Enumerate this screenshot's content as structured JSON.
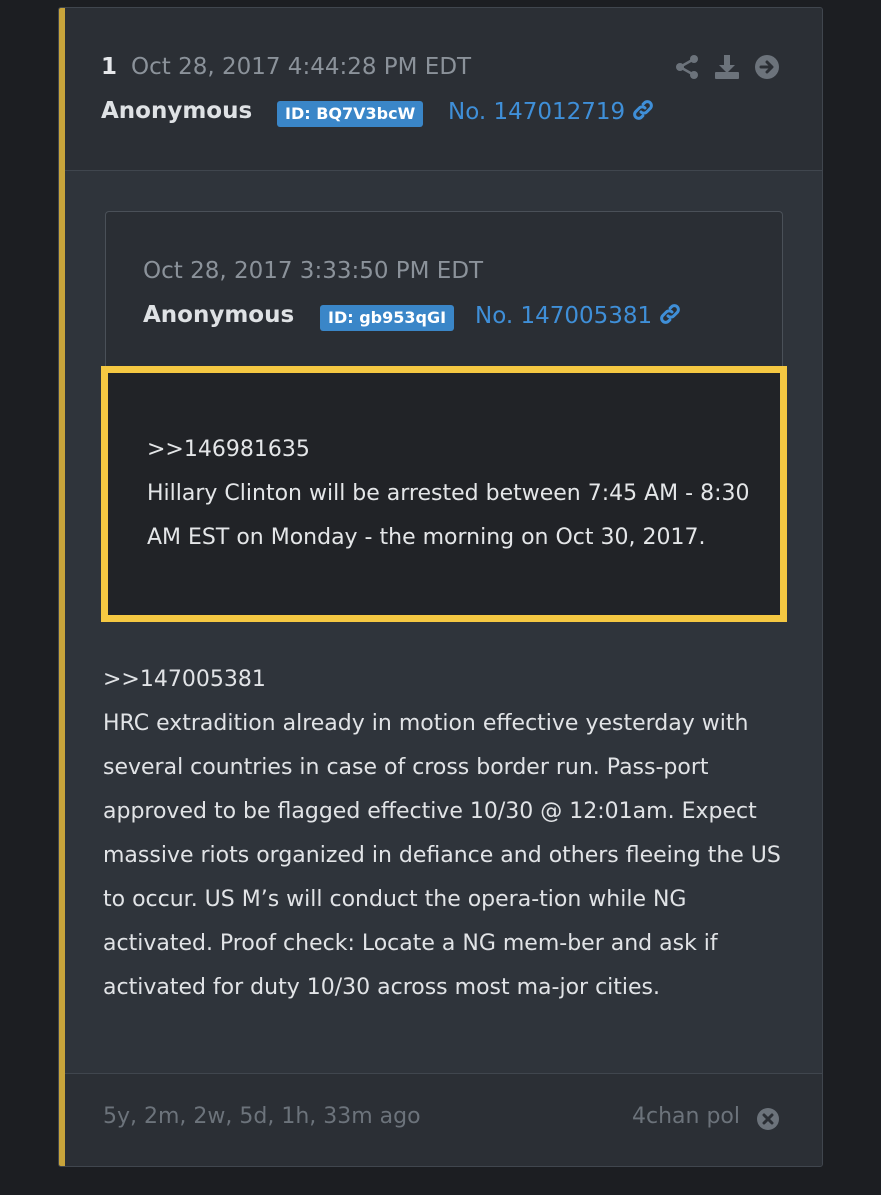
{
  "post": {
    "number": "1",
    "date": "Oct 28, 2017 4:44:28 PM EDT",
    "author": "Anonymous",
    "id": "ID: BQ7V3bcW",
    "post_no": "No. 147012719",
    "icons": [
      "share-icon",
      "download-icon",
      "arrow-right-circle-icon"
    ]
  },
  "quoted": {
    "date": "Oct 28, 2017 3:33:50 PM EDT",
    "author": "Anonymous",
    "id": "ID: gb953qGI",
    "post_no": "No. 147005381",
    "lines": [
      ">>146981635",
      "Hillary Clinton will be arrested between 7:45 AM - 8:30 AM EST on Monday - the morning on Oct 30, 2017."
    ]
  },
  "body": {
    "lines": [
      ">>147005381",
      "HRC extradition already in motion effective yesterday with several countries in case of cross border run. Pass-port approved to be flagged effective 10/30 @ 12:01am. Expect massive riots organized in defiance and others fleeing the US to occur. US M’s will conduct the opera-tion while NG activated. Proof check: Locate a NG mem-ber and ask if activated for duty 10/30 across most ma-jor cities."
    ]
  },
  "footer": {
    "ago": "5y, 2m, 2w, 5d, 1h, 33m ago",
    "source": "4chan pol"
  },
  "colors": {
    "accent": "#c8a43b",
    "highlight_border": "#f5c842",
    "link": "#3f8fd8",
    "badge": "#3a86c8"
  }
}
